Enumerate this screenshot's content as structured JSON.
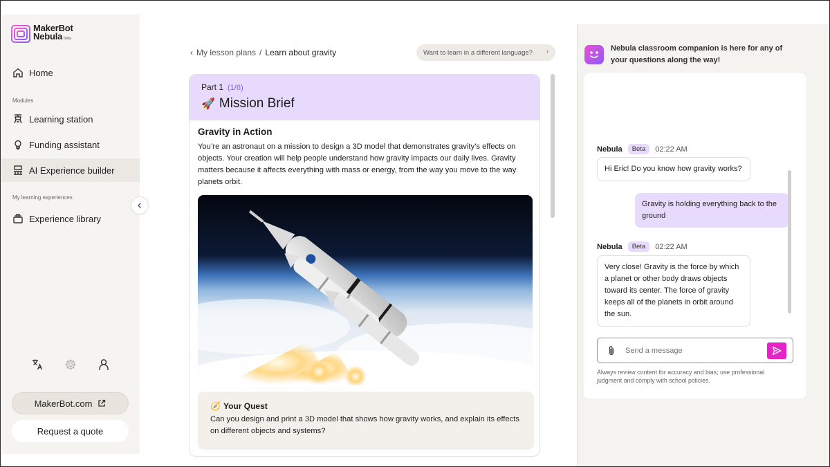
{
  "brand": {
    "name_line1": "MakerBot",
    "name_line2": "Nebula",
    "tag": "beta",
    "accent": "#8b5cf6",
    "pink": "#e423c9"
  },
  "sidebar": {
    "home": "Home",
    "modules_label": "Modules",
    "modules": [
      {
        "label": "Learning station",
        "icon": "learning-station-icon"
      },
      {
        "label": "Funding assistant",
        "icon": "lightbulb-icon"
      },
      {
        "label": "AI Experience builder",
        "icon": "experience-builder-icon",
        "active": true
      }
    ],
    "experiences_label": "My learning experiences",
    "experience_library": "Experience library",
    "footer_icons": [
      "translate-icon",
      "gear-icon",
      "user-icon"
    ],
    "makerbot_link": "MakerBot.com",
    "request_quote": "Request a quote"
  },
  "breadcrumb": {
    "parent": "My lesson plans",
    "separator": "/",
    "current": "Learn about gravity"
  },
  "language_button": "Want to learn in a different language?",
  "lesson": {
    "part_label": "Part 1",
    "part_count": "(1/6)",
    "title_emoji": "🚀",
    "title": "Mission Brief",
    "section_title": "Gravity in Action",
    "paragraph": "You’re an astronaut on a mission to design a 3D model that demonstrates gravity’s effects on objects. Your creation will help people understand how gravity impacts our daily lives. Gravity matters because it affects everything with mass or energy, from the way you move to the way planets orbit.",
    "quest_emoji": "🧭",
    "quest_title": "Your Quest",
    "quest_text": "Can you design and print a 3D model that shows how gravity works, and explain its effects on different objects and systems?"
  },
  "chat": {
    "header": "Nebula classroom companion is here for any of your questions along the way!",
    "messages": [
      {
        "sender": "Nebula",
        "badge": "Beta",
        "time": "02:22 AM",
        "text": "Hi Eric! Do you know how gravity works?"
      },
      {
        "sender": "user",
        "text": "Gravity is holding everything back to the ground"
      },
      {
        "sender": "Nebula",
        "badge": "Beta",
        "time": "02:22 AM",
        "text": "Very close! Gravity is the force by which a planet or other body draws objects toward its center. The force of gravity keeps all of the planets in orbit around the sun."
      }
    ],
    "input_placeholder": "Send a message",
    "disclaimer": "Always review content for accuracy and bias; use professional judgment and comply with school policies."
  }
}
